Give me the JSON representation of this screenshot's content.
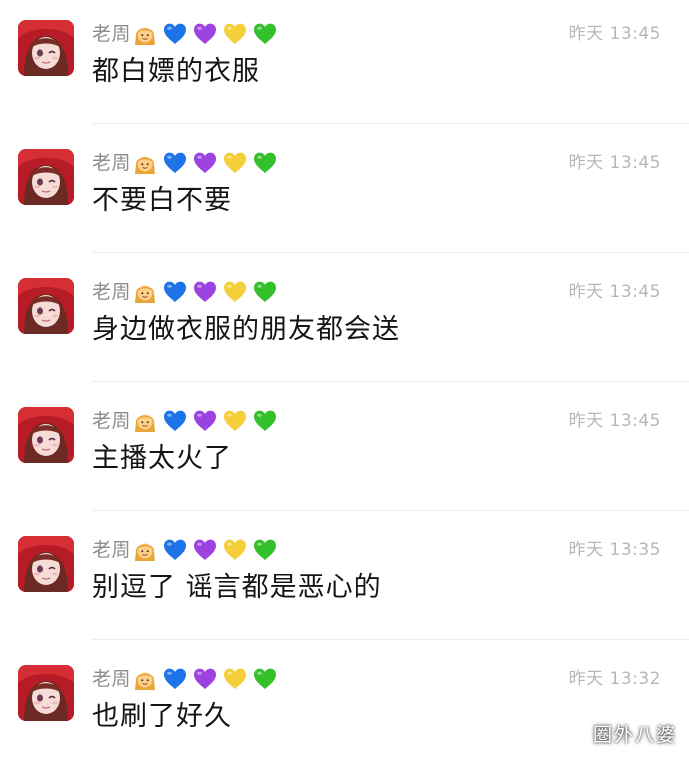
{
  "messages": [
    {
      "sender": "老周",
      "emoji_icons": [
        "person-emoji",
        "blue-heart-icon",
        "purple-heart-icon",
        "yellow-heart-icon",
        "green-heart-icon"
      ],
      "time": "昨天 13:45",
      "text": "都白嫖的衣服"
    },
    {
      "sender": "老周",
      "emoji_icons": [
        "person-emoji",
        "blue-heart-icon",
        "purple-heart-icon",
        "yellow-heart-icon",
        "green-heart-icon"
      ],
      "time": "昨天 13:45",
      "text": "不要白不要"
    },
    {
      "sender": "老周",
      "emoji_icons": [
        "person-emoji",
        "blue-heart-icon",
        "purple-heart-icon",
        "yellow-heart-icon",
        "green-heart-icon"
      ],
      "time": "昨天 13:45",
      "text": "身边做衣服的朋友都会送"
    },
    {
      "sender": "老周",
      "emoji_icons": [
        "person-emoji",
        "blue-heart-icon",
        "purple-heart-icon",
        "yellow-heart-icon",
        "green-heart-icon"
      ],
      "time": "昨天 13:45",
      "text": "主播太火了"
    },
    {
      "sender": "老周",
      "emoji_icons": [
        "person-emoji",
        "blue-heart-icon",
        "purple-heart-icon",
        "yellow-heart-icon",
        "green-heart-icon"
      ],
      "time": "昨天 13:35",
      "text": "别逗了 谣言都是恶心的"
    },
    {
      "sender": "老周",
      "emoji_icons": [
        "person-emoji",
        "blue-heart-icon",
        "purple-heart-icon",
        "yellow-heart-icon",
        "green-heart-icon"
      ],
      "time": "昨天 13:32",
      "text": "也刷了好久"
    }
  ],
  "watermark": "圈外八婆",
  "colors": {
    "sender_name": "#8d8d8d",
    "timestamp": "#b7b7b7",
    "message_text": "#151515",
    "divider": "#ececec",
    "blue_heart": "#1e73e8",
    "purple_heart": "#9b42e0",
    "yellow_heart": "#f5cf3a",
    "green_heart": "#34c02a"
  }
}
